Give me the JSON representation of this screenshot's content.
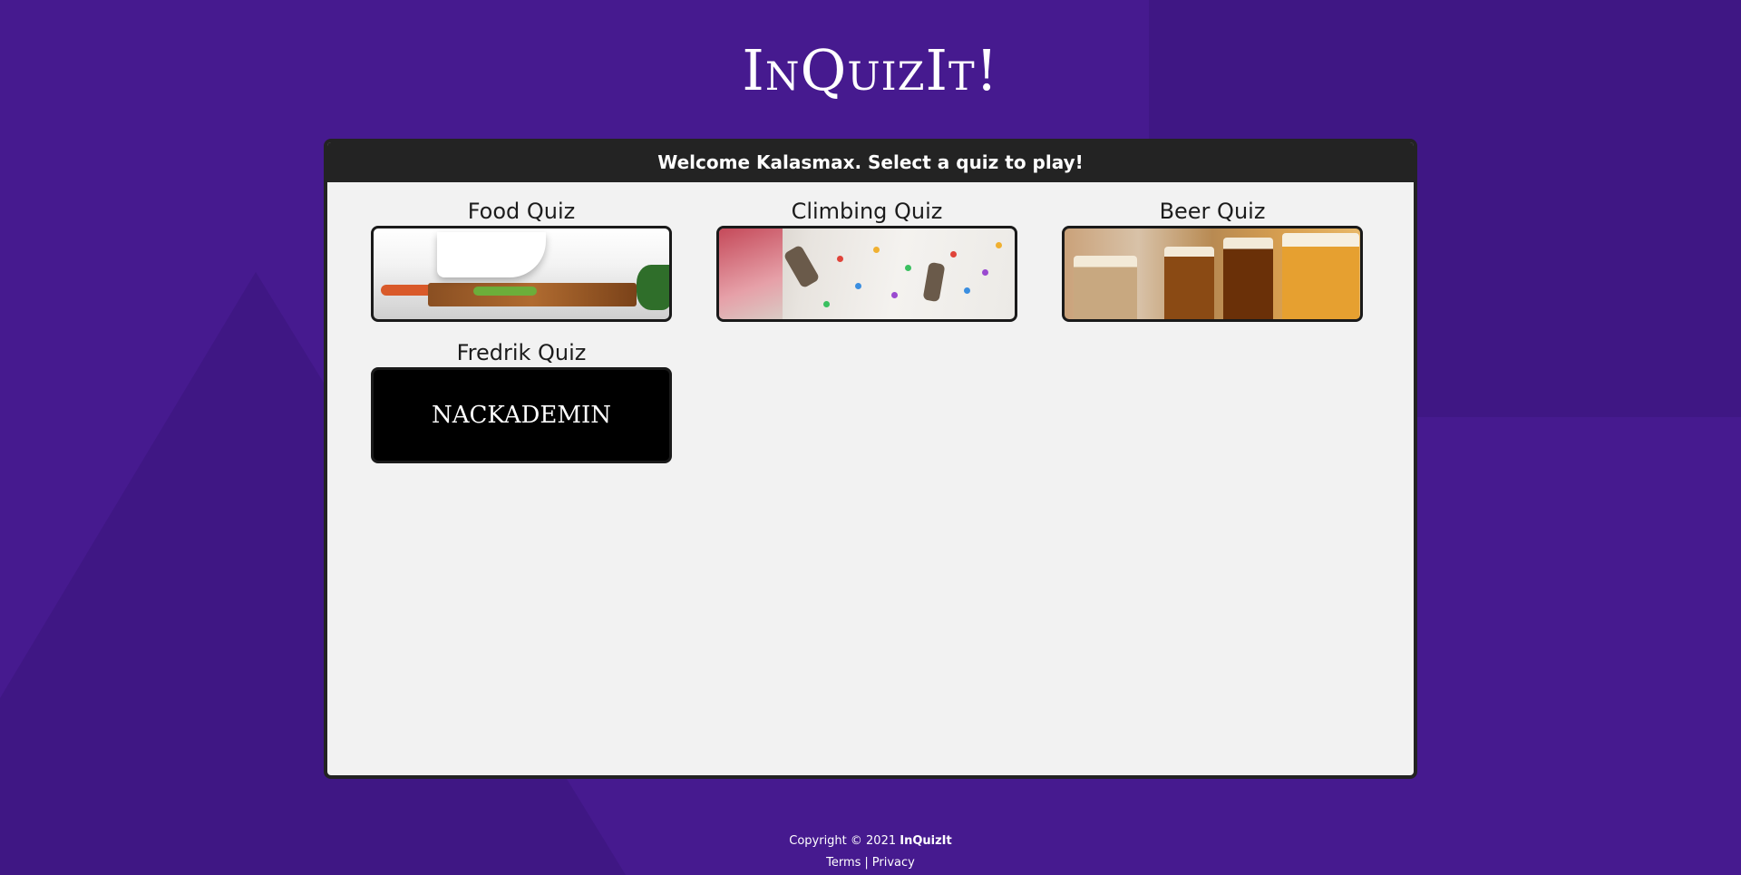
{
  "app": {
    "logo_text": "InQuizIt!"
  },
  "panel": {
    "header": "Welcome Kalasmax. Select a quiz to play!"
  },
  "quizzes": [
    {
      "title": "Food Quiz"
    },
    {
      "title": "Climbing Quiz"
    },
    {
      "title": "Beer Quiz"
    },
    {
      "title": "Fredrik Quiz",
      "thumb_text": "NACKADEMIN"
    }
  ],
  "footer": {
    "copyright_prefix": "Copyright © 2021",
    "brand": "InQuizIt",
    "terms": "Terms",
    "separator": "|",
    "privacy": "Privacy"
  },
  "colors": {
    "background": "#461a8f",
    "panel_header": "#232323",
    "panel_body": "#f2f2f2"
  }
}
